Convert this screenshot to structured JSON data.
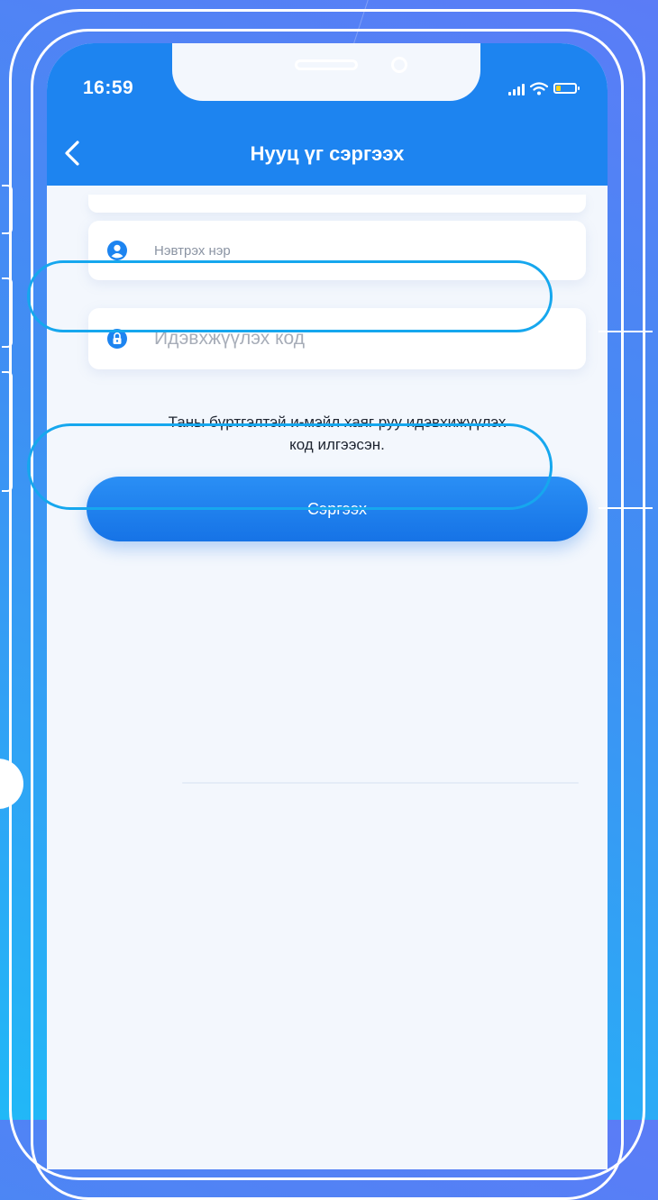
{
  "status_bar": {
    "time": "16:59",
    "battery_color": "#ffd21a"
  },
  "header": {
    "title": "Нууц үг сэргээх",
    "back_icon": "chevron-left-icon",
    "background_color": "#1d84f0"
  },
  "form": {
    "username": {
      "placeholder": "Нэвтрэх нэр",
      "value": "",
      "icon": "user-icon"
    },
    "activation_code": {
      "placeholder": "Идэвхжүүлэх код",
      "value": "",
      "icon": "lock-icon"
    },
    "info_line1": "Таны бүртгэлтэй и-мэйл хаяг руу идэвхижүүлэх",
    "info_line2": "код илгээсэн.",
    "submit_label": "Сэргээх"
  },
  "colors": {
    "accent": "#1d84f0",
    "highlight_ring": "#16a7ee",
    "screen_background": "#f3f7fd"
  }
}
